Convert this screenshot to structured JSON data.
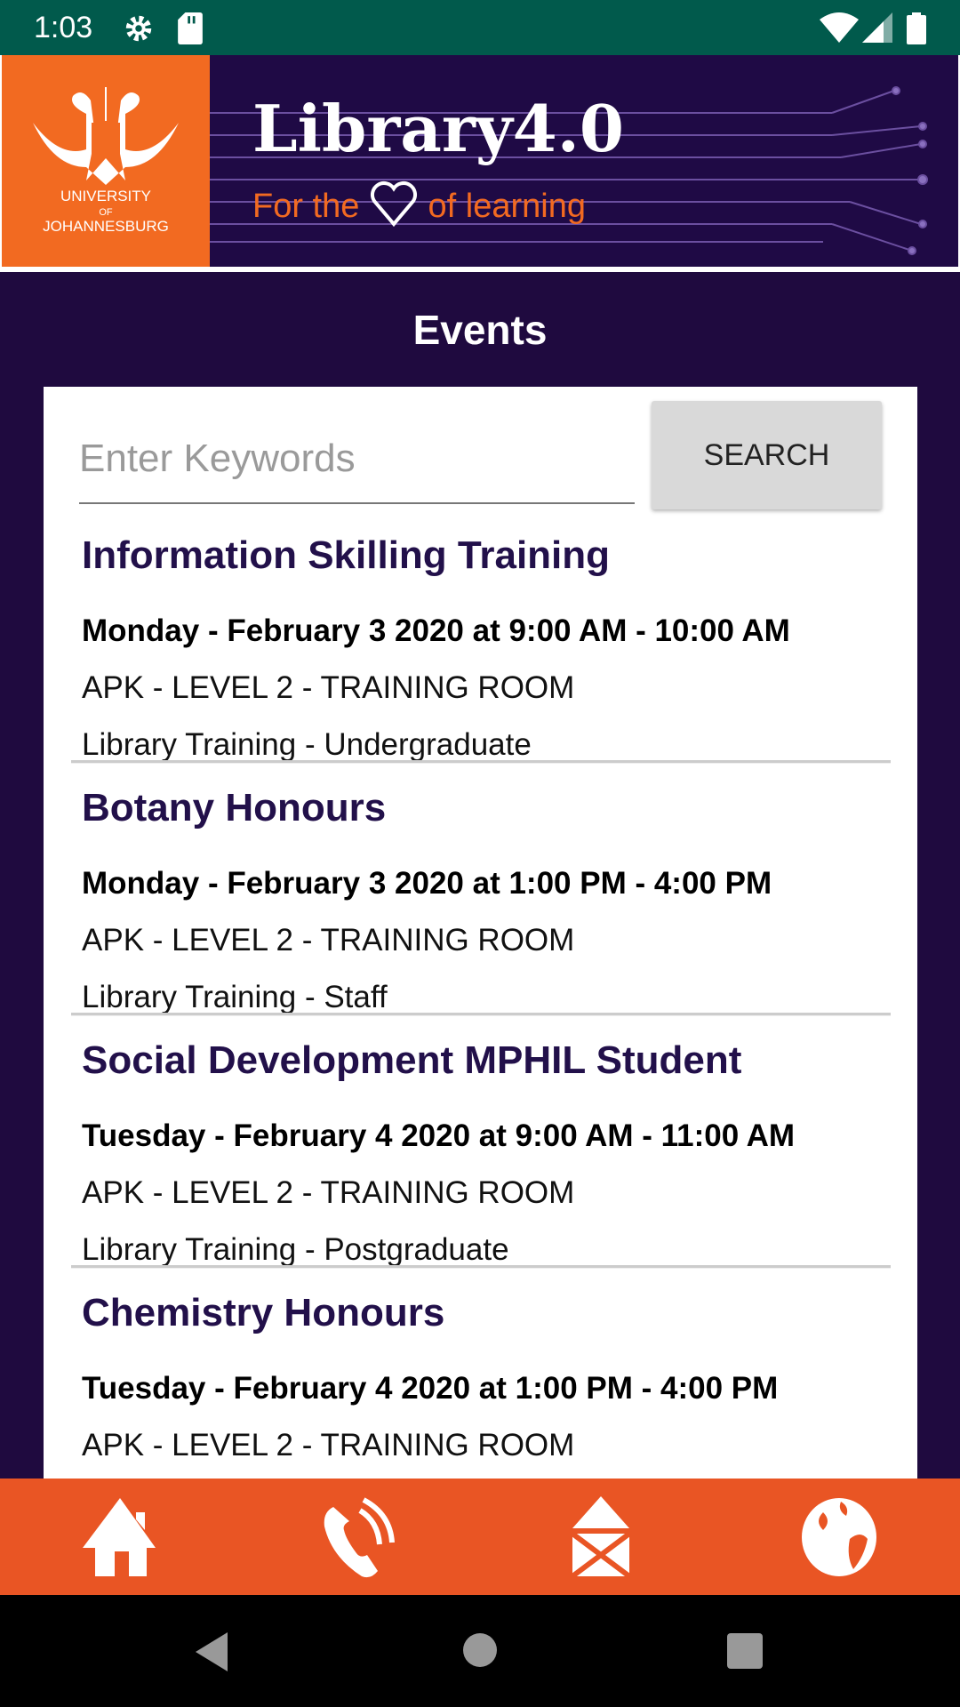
{
  "status_bar": {
    "time": "1:03",
    "icons": [
      "settings-icon",
      "sd-card-icon",
      "wifi-icon",
      "signal-icon",
      "battery-icon"
    ]
  },
  "banner": {
    "logo_line1": "UNIVERSITY",
    "logo_line2": "OF",
    "logo_line3": "JOHANNESBURG",
    "brand": "Library4.0",
    "tagline_a": "For the",
    "tagline_b": "of learning"
  },
  "page_title": "Events",
  "search": {
    "placeholder": "Enter Keywords",
    "value": "",
    "button": "SEARCH"
  },
  "events": [
    {
      "title": "Information Skilling Training",
      "datetime": "Monday - February 3 2020 at 9:00 AM - 10:00 AM",
      "location": "APK - LEVEL 2 - TRAINING ROOM",
      "category": "Library Training - Undergraduate"
    },
    {
      "title": "Botany Honours",
      "datetime": "Monday - February 3 2020 at 1:00 PM - 4:00 PM",
      "location": "APK - LEVEL 2 - TRAINING ROOM",
      "category": "Library Training - Staff"
    },
    {
      "title": "Social Development MPHIL Student",
      "datetime": "Tuesday - February 4 2020 at 9:00 AM - 11:00 AM",
      "location": "APK - LEVEL 2 - TRAINING ROOM",
      "category": "Library Training - Postgraduate"
    },
    {
      "title": "Chemistry Honours",
      "datetime": "Tuesday - February 4 2020 at 1:00 PM - 4:00 PM",
      "location": "APK - LEVEL 2 - TRAINING ROOM",
      "category": ""
    }
  ],
  "bottom_nav": [
    "home-icon",
    "phone-icon",
    "mail-icon",
    "globe-icon"
  ],
  "colors": {
    "status": "#015a4c",
    "header": "#1f0a3f",
    "accent": "#e95524",
    "title_text": "#22104a"
  }
}
